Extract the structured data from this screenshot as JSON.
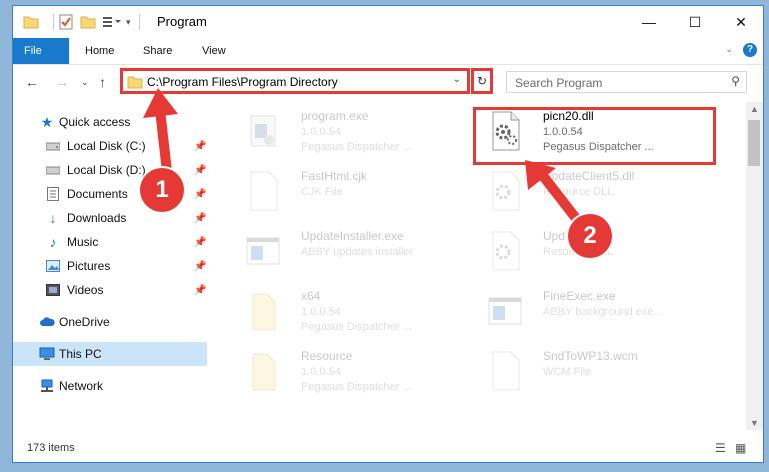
{
  "window": {
    "title": "Program",
    "controls": {
      "minimize": "—",
      "maximize": "☐",
      "close": "✕"
    }
  },
  "ribbon": {
    "tabs": [
      {
        "label": "File"
      },
      {
        "label": "Home"
      },
      {
        "label": "Share"
      },
      {
        "label": "View"
      }
    ],
    "help": "?"
  },
  "address": {
    "path": "C:\\Program Files\\Program Directory",
    "search_placeholder": "Search Program"
  },
  "nav": {
    "items": [
      {
        "label": "Quick access",
        "icon": "star-icon",
        "pinned": false
      },
      {
        "label": "Local Disk (C:)",
        "icon": "drive-icon",
        "pinned": true
      },
      {
        "label": "Local Disk (D:)",
        "icon": "drive-icon",
        "pinned": true
      },
      {
        "label": "Documents",
        "icon": "documents-icon",
        "pinned": true
      },
      {
        "label": "Downloads",
        "icon": "download-icon",
        "pinned": true
      },
      {
        "label": "Music",
        "icon": "music-icon",
        "pinned": true
      },
      {
        "label": "Pictures",
        "icon": "pictures-icon",
        "pinned": true
      },
      {
        "label": "Videos",
        "icon": "videos-icon",
        "pinned": true
      },
      {
        "label": "OneDrive",
        "icon": "cloud-icon",
        "pinned": false
      },
      {
        "label": "This PC",
        "icon": "computer-icon",
        "pinned": false,
        "selected": true
      },
      {
        "label": "Network",
        "icon": "network-icon",
        "pinned": false
      }
    ]
  },
  "files": [
    {
      "name": "program.exe",
      "meta1": "1.0.0.54",
      "meta2": "Pegasus Dispatcher ...",
      "icon": "exe-icon",
      "faded": true
    },
    {
      "name": "picn20.dll",
      "meta1": "1.0.0.54",
      "meta2": "Pegasus Dispatcher ...",
      "icon": "dll-gear-icon",
      "faded": false,
      "highlighted": true
    },
    {
      "name": "FastHtml.cjk",
      "meta1": "CJK File",
      "meta2": "",
      "icon": "blank-file-icon",
      "faded": true
    },
    {
      "name": "UpdateClient5.dll",
      "meta1": "Resource DLL",
      "meta2": "",
      "icon": "dll-gear-icon",
      "faded": true
    },
    {
      "name": "UpdateInstaller.exe",
      "meta1": "ABBY updates installer",
      "meta2": "",
      "icon": "window-exe-icon",
      "faded": true
    },
    {
      "name": "Update...9.dll",
      "meta1": "Resource DLL",
      "meta2": "",
      "icon": "dll-gear-icon",
      "faded": true
    },
    {
      "name": "x64",
      "meta1": "1.0.0.54",
      "meta2": "Pegasus Dispatcher ...",
      "icon": "folder-file-icon",
      "faded": true
    },
    {
      "name": "FineExec.exe",
      "meta1": "ABBY background exe...",
      "meta2": "",
      "icon": "window-exe-icon",
      "faded": true
    },
    {
      "name": "Resource",
      "meta1": "1.0.0.54",
      "meta2": "Pegasus Dispatcher ...",
      "icon": "folder-file-icon",
      "faded": true
    },
    {
      "name": "SndToWP13.wcm",
      "meta1": "WCM File",
      "meta2": "",
      "icon": "blank-file-icon",
      "faded": true
    }
  ],
  "status": {
    "item_count": "173 items"
  },
  "annotations": {
    "step1": "1",
    "step2": "2"
  },
  "colors": {
    "accent": "#1979ca",
    "highlight": "#e53935"
  }
}
